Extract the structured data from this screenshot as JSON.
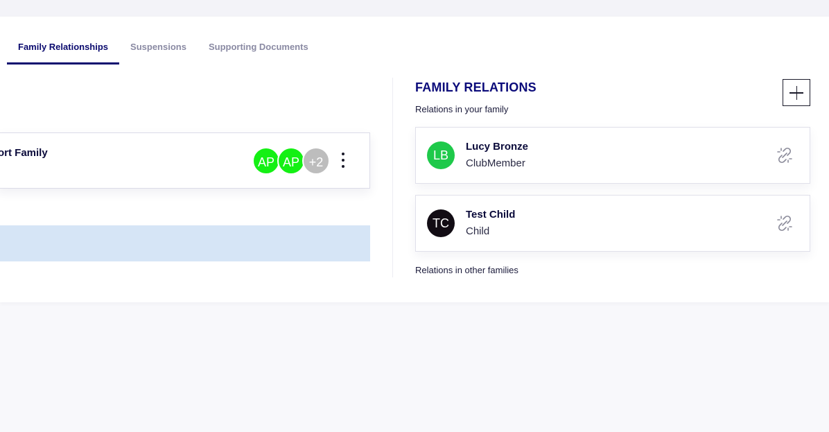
{
  "tabs": [
    {
      "label": "Family Relationships",
      "active": true
    },
    {
      "label": "Suspensions",
      "active": false
    },
    {
      "label": "Supporting Documents",
      "active": false
    }
  ],
  "family_card": {
    "name": "ort Family",
    "avatars": [
      "AP",
      "AP"
    ],
    "more_count": "+2",
    "avatar_color": "#14f014"
  },
  "relations": {
    "title": "FAMILY RELATIONS",
    "subtitle": "Relations in your family",
    "members": [
      {
        "initials": "LB",
        "name": "Lucy Bronze",
        "role": "ClubMember",
        "color": "#1ec94a"
      },
      {
        "initials": "TC",
        "name": "Test Child",
        "role": "Child",
        "color": "#120c14"
      }
    ],
    "other_label": "Relations in other families"
  },
  "colors": {
    "accent": "#0a0a6e",
    "highlight_row": "#d6e5f6"
  },
  "icons": {
    "add": "plus-icon",
    "menu": "kebab-menu-icon",
    "unlink": "unlink-icon"
  }
}
